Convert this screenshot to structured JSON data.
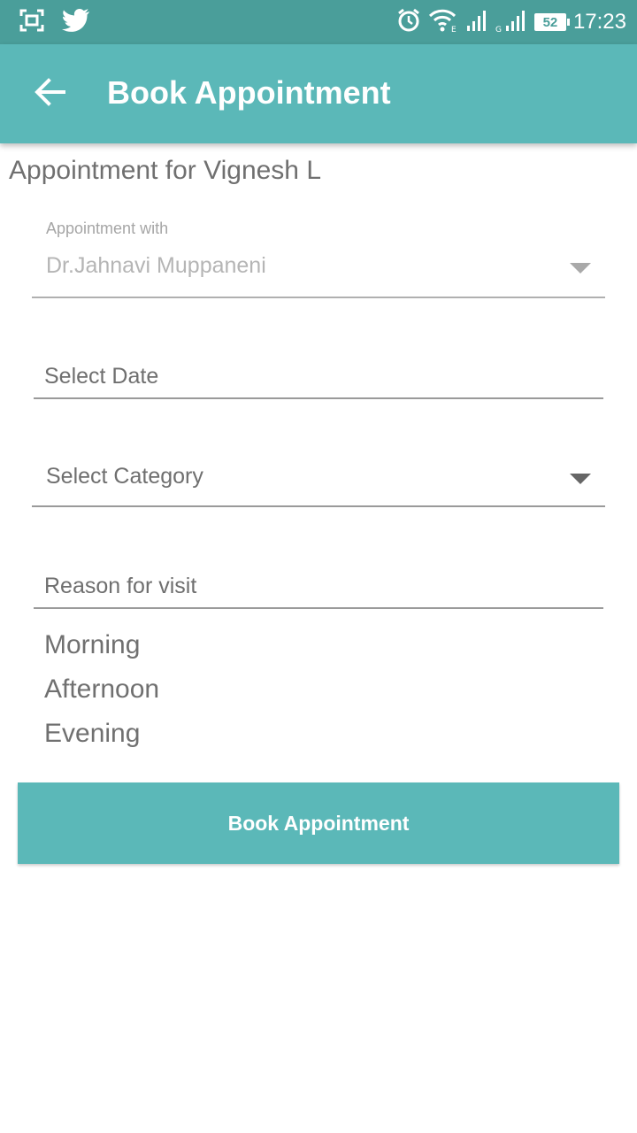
{
  "status_bar": {
    "time": "17:23",
    "battery": "52",
    "icons": [
      "screenshot-icon",
      "twitter-icon",
      "alarm-icon",
      "wifi-icon",
      "signal-icon",
      "signal-icon-2"
    ]
  },
  "app_bar": {
    "title": "Book Appointment",
    "back_icon": "arrow-back-icon"
  },
  "form": {
    "subtitle": "Appointment for Vignesh L",
    "doctor_label": "Appointment with",
    "doctor_value": "Dr.Jahnavi Muppaneni",
    "date_hint": "Select Date",
    "category_hint": "Select Category",
    "reason_hint": "Reason for visit",
    "slots": [
      "Morning",
      "Afternoon",
      "Evening"
    ],
    "submit_label": "Book Appointment"
  },
  "colors": {
    "status_bar": "#4a9e9a",
    "accent": "#5bb8b8",
    "text_secondary": "#707070"
  }
}
